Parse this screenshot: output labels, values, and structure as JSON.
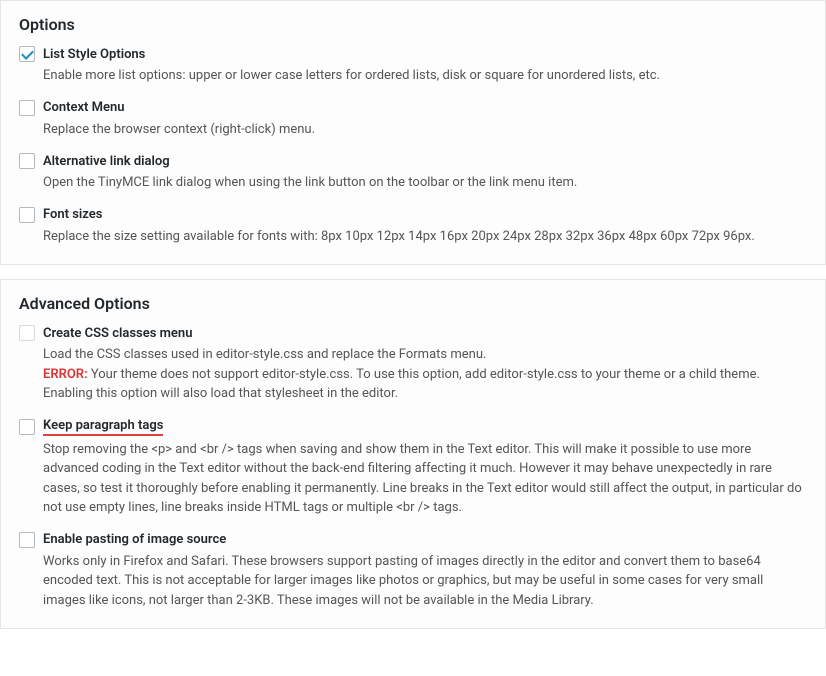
{
  "sections": {
    "options": {
      "title": "Options",
      "items": [
        {
          "label": "List Style Options",
          "checked": true,
          "disabled": false,
          "desc": "Enable more list options: upper or lower case letters for ordered lists, disk or square for unordered lists, etc."
        },
        {
          "label": "Context Menu",
          "checked": false,
          "disabled": false,
          "desc": "Replace the browser context (right-click) menu."
        },
        {
          "label": "Alternative link dialog",
          "checked": false,
          "disabled": false,
          "desc": "Open the TinyMCE link dialog when using the link button on the toolbar or the link menu item."
        },
        {
          "label": "Font sizes",
          "checked": false,
          "disabled": false,
          "desc": "Replace the size setting available for fonts with: 8px 10px 12px 14px 16px 20px 24px 28px 32px 36px 48px 60px 72px 96px."
        }
      ]
    },
    "advanced": {
      "title": "Advanced Options",
      "items": [
        {
          "label": "Create CSS classes menu",
          "checked": false,
          "disabled": true,
          "desc_line1": "Load the CSS classes used in editor-style.css and replace the Formats menu.",
          "error_prefix": "ERROR:",
          "error_text": " Your theme does not support editor-style.css. To use this option, add editor-style.css to your theme or a child theme. Enabling this option will also load that stylesheet in the editor."
        },
        {
          "label": "Keep paragraph tags",
          "checked": false,
          "disabled": false,
          "underline": true,
          "desc": "Stop removing the <p> and <br /> tags when saving and show them in the Text editor. This will make it possible to use more advanced coding in the Text editor without the back-end filtering affecting it much. However it may behave unexpectedly in rare cases, so test it thoroughly before enabling it permanently. Line breaks in the Text editor would still affect the output, in particular do not use empty lines, line breaks inside HTML tags or multiple <br /> tags."
        },
        {
          "label": "Enable pasting of image source",
          "checked": false,
          "disabled": false,
          "desc": "Works only in Firefox and Safari. These browsers support pasting of images directly in the editor and convert them to base64 encoded text. This is not acceptable for larger images like photos or graphics, but may be useful in some cases for very small images like icons, not larger than 2-3KB. These images will not be available in the Media Library."
        }
      ]
    }
  }
}
